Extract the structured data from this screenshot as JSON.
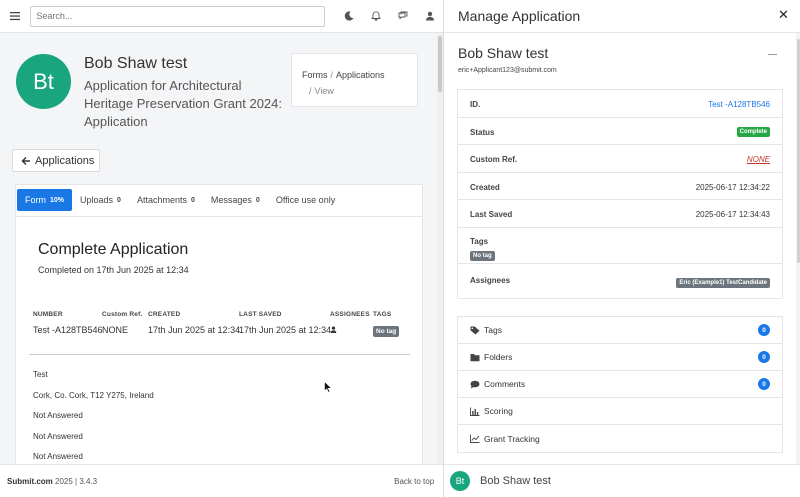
{
  "topbar": {
    "search_placeholder": "Search...",
    "icons": [
      "menu-icon",
      "moon-icon",
      "bell-icon",
      "chat-icon",
      "user-icon"
    ]
  },
  "applicant": {
    "avatar_initials": "Bt",
    "name": "Bob Shaw test",
    "application_title": "Application for Architectural Heritage Preservation Grant 2024: Application"
  },
  "breadcrumb": {
    "items": [
      "Forms",
      "Applications"
    ],
    "separator": "/",
    "current": "View"
  },
  "back_button": {
    "label": "Applications"
  },
  "tabs": [
    {
      "label": "Form",
      "count": "10%"
    },
    {
      "label": "Uploads",
      "count": "0"
    },
    {
      "label": "Attachments",
      "count": "0"
    },
    {
      "label": "Messages",
      "count": "0"
    },
    {
      "label": "Office use only",
      "count": ""
    }
  ],
  "form": {
    "heading": "Complete Application",
    "completed_on": "Completed on 17th Jun 2025 at 12:34",
    "summary": {
      "headers": [
        "NUMBER",
        "Custom Ref.",
        "CREATED",
        "LAST SAVED",
        "ASSIGNEES",
        "TAGS"
      ],
      "number": "Test -A128TB546",
      "custom_ref": "NONE",
      "created": "17th Jun 2025 at 12:34",
      "last_saved": "17th Jun 2025 at 12:34",
      "tag": "No tag"
    },
    "answers": [
      "Test",
      "Cork, Co. Cork, T12 Y275, Ireland",
      "Not Answered",
      "Not Answered",
      "Not Answered"
    ]
  },
  "footer": {
    "brand": "Submit.com",
    "year_version": "2025 | 3.4.3",
    "back_to_top": "Back to top"
  },
  "drawer": {
    "title": "Manage Application",
    "name": "Bob Shaw test",
    "email": "eric+Applicant123@submit.com",
    "details": {
      "id_label": "ID.",
      "id_value": "Test -A128TB546",
      "status_label": "Status",
      "status_value": "Complete",
      "custom_ref_label": "Custom Ref.",
      "custom_ref_value": "NONE",
      "created_label": "Created",
      "created_value": "2025-06-17 12:34:22",
      "last_saved_label": "Last Saved",
      "last_saved_value": "2025-06-17 12:34:43",
      "tags_label": "Tags",
      "tags_value": "No tag",
      "assignees_label": "Assignees",
      "assignees_value": "Eric (Example1) TestCandidate"
    },
    "sections": [
      {
        "label": "Tags",
        "count": "0",
        "icon": "tag-icon"
      },
      {
        "label": "Folders",
        "count": "0",
        "icon": "folder-icon"
      },
      {
        "label": "Comments",
        "count": "0",
        "icon": "comment-icon"
      },
      {
        "label": "Scoring",
        "count": "",
        "icon": "bar-chart-icon"
      },
      {
        "label": "Grant Tracking",
        "count": "",
        "icon": "line-chart-icon"
      }
    ],
    "footer_initials": "Bt",
    "footer_name": "Bob Shaw test"
  },
  "colors": {
    "primary": "#1977e6",
    "avatar": "#19a67e",
    "status_complete": "#28a745",
    "tag_grey": "#6c757d"
  }
}
